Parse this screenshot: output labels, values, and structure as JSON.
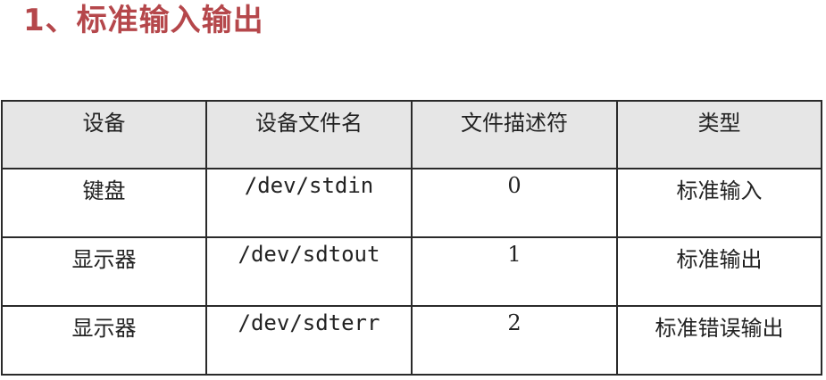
{
  "slide": {
    "title": "1、标准输入输出"
  },
  "table": {
    "headers": [
      "设备",
      "设备文件名",
      "文件描述符",
      "类型"
    ],
    "rows": [
      [
        "键盘",
        "/dev/stdin",
        "0",
        "标准输入"
      ],
      [
        "显示器",
        "/dev/sdtout",
        "1",
        "标准输出"
      ],
      [
        "显示器",
        "/dev/sdterr",
        "2",
        "标准错误输出"
      ]
    ]
  },
  "colors": {
    "title": "#b5474b",
    "header_background": "#e6e6e6",
    "border": "#2a2a2a"
  }
}
